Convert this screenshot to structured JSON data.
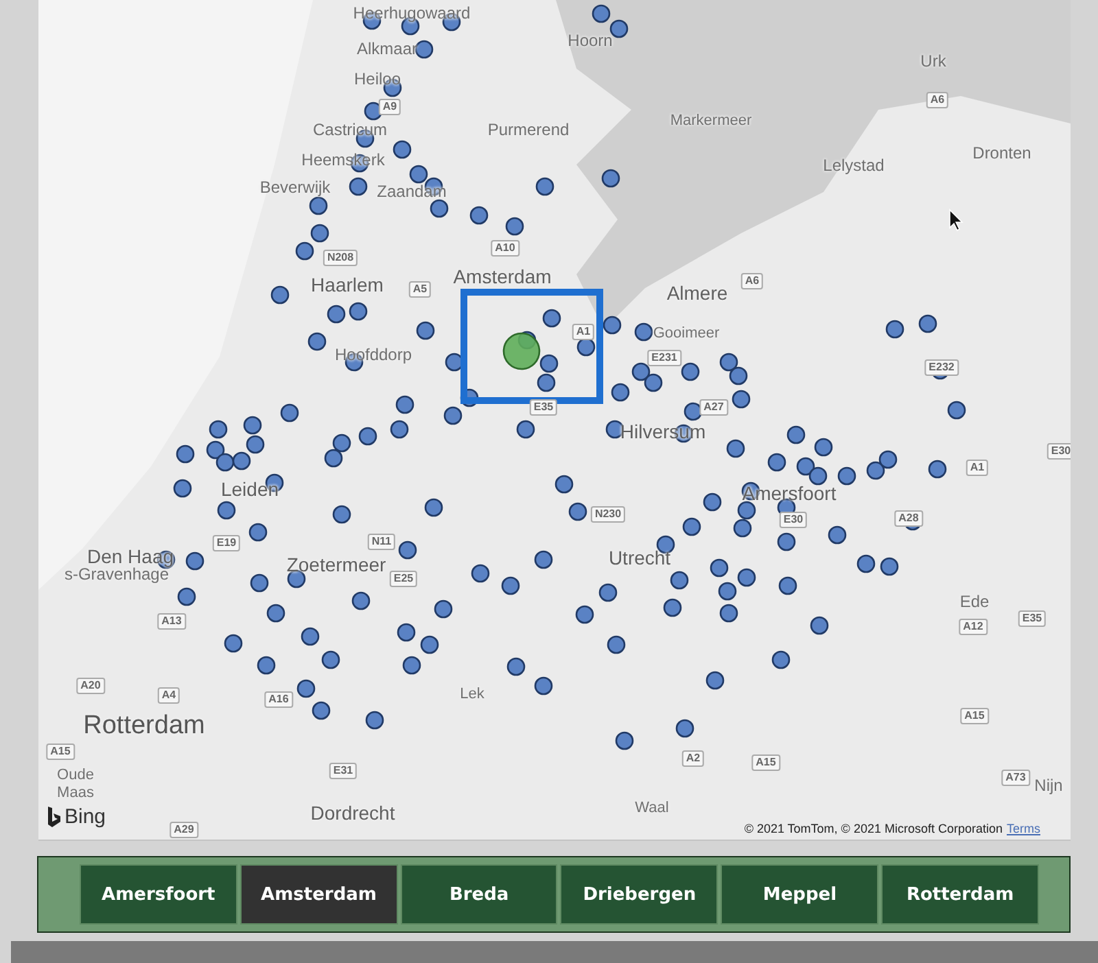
{
  "map": {
    "places": [
      {
        "kind": "town",
        "label": "Heerhugowaard"
      },
      {
        "kind": "town",
        "label": "Alkmaar"
      },
      {
        "kind": "town",
        "label": "Hoorn"
      },
      {
        "kind": "town",
        "label": "Urk"
      },
      {
        "kind": "town",
        "label": "Heiloo"
      },
      {
        "kind": "water",
        "label": "Markermeer"
      },
      {
        "kind": "town",
        "label": "Castricum"
      },
      {
        "kind": "town",
        "label": "Purmerend"
      },
      {
        "kind": "town",
        "label": "Lelystad"
      },
      {
        "kind": "town",
        "label": "Dronten"
      },
      {
        "kind": "town",
        "label": "Heemskerk"
      },
      {
        "kind": "town",
        "label": "Beverwijk"
      },
      {
        "kind": "town",
        "label": "Zaandam"
      },
      {
        "kind": "city",
        "label": "Haarlem"
      },
      {
        "kind": "city",
        "label": "Amsterdam"
      },
      {
        "kind": "city",
        "label": "Almere"
      },
      {
        "kind": "water",
        "label": "Gooimeer"
      },
      {
        "kind": "town",
        "label": "Hoofddorp"
      },
      {
        "kind": "city",
        "label": "Hilversum"
      },
      {
        "kind": "city",
        "label": "Leiden"
      },
      {
        "kind": "city",
        "label": "Amersfoort"
      },
      {
        "kind": "city",
        "label": "Den Haag"
      },
      {
        "kind": "town",
        "label": "s-Gravenhage"
      },
      {
        "kind": "city",
        "label": "Zoetermeer"
      },
      {
        "kind": "city",
        "label": "Utrecht"
      },
      {
        "kind": "town",
        "label": "Ede"
      },
      {
        "kind": "big",
        "label": "Rotterdam"
      },
      {
        "kind": "water",
        "label": "Lek"
      },
      {
        "kind": "water",
        "label": "Oude"
      },
      {
        "kind": "water",
        "label": "Maas"
      },
      {
        "kind": "city",
        "label": "Dordrecht"
      },
      {
        "kind": "water",
        "label": "Waal"
      },
      {
        "kind": "town",
        "label": "Nijn"
      }
    ],
    "roads": [
      "A9",
      "N208",
      "A10",
      "A5",
      "A6",
      "A6",
      "A1",
      "E231",
      "E232",
      "A27",
      "E35",
      "E30",
      "A1",
      "N230",
      "E30",
      "A28",
      "E19",
      "N11",
      "E25",
      "A13",
      "A12",
      "E35",
      "A20",
      "A4",
      "A16",
      "A15",
      "E31",
      "A2",
      "A15",
      "A15",
      "A73",
      "A29"
    ],
    "logo": "Bing",
    "copyright": "© 2021 TomTom, © 2021 Microsoft Corporation",
    "terms_link": "Terms"
  },
  "slicer": [
    {
      "label": "Amersfoort",
      "selected": false
    },
    {
      "label": "Amsterdam",
      "selected": true
    },
    {
      "label": "Breda",
      "selected": false
    },
    {
      "label": "Driebergen",
      "selected": false
    },
    {
      "label": "Meppel",
      "selected": false
    },
    {
      "label": "Rotterdam",
      "selected": false
    }
  ]
}
